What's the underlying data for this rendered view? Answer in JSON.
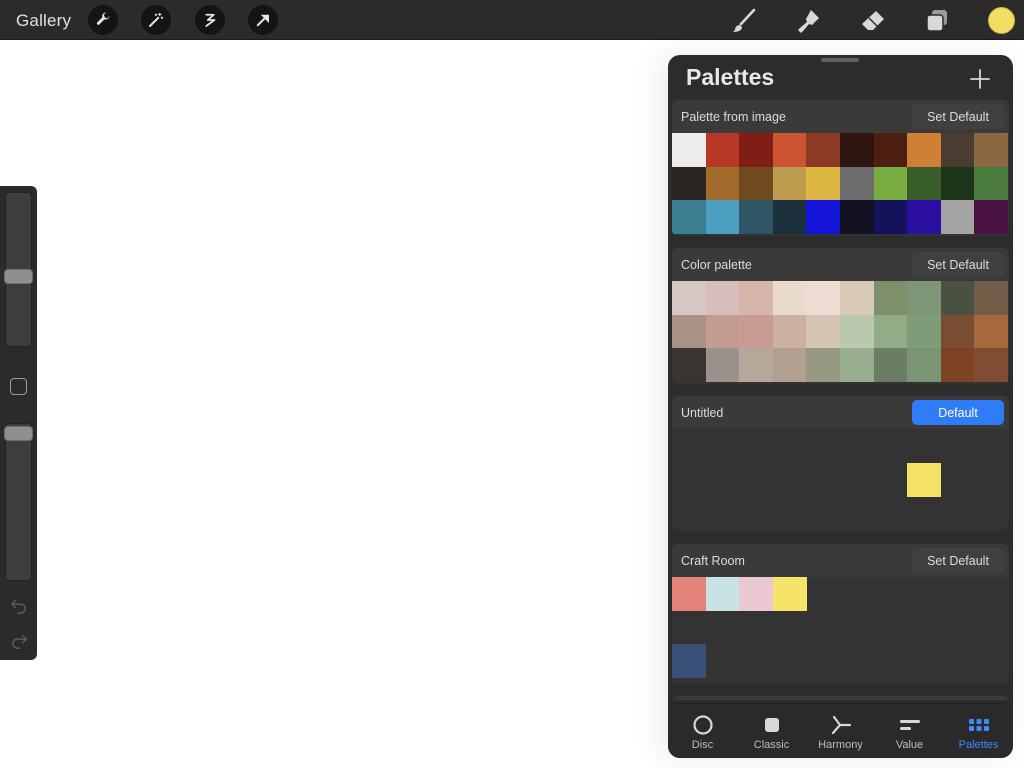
{
  "toolbar": {
    "gallery_label": "Gallery",
    "left_tools": [
      "wrench-icon",
      "magic-wand-icon",
      "selection-icon",
      "transform-arrow-icon"
    ],
    "right_tools": [
      "brush-icon",
      "smudge-icon",
      "eraser-icon",
      "layers-icon"
    ],
    "current_color": "#f3dd63"
  },
  "sidebar": {
    "brush_size_level": 0.55,
    "opacity_level": 0.0
  },
  "panel": {
    "title": "Palettes",
    "palettes": [
      {
        "name": "Palette from image",
        "button_label": "Set Default",
        "is_default": false,
        "swatches": [
          "#ececec",
          "#b83826",
          "#7e1e16",
          "#cc5433",
          "#8c3a26",
          "#2e1510",
          "#4d1e12",
          "#d07f37",
          "#4a3c30",
          "#8c6840",
          "#2b2621",
          "#a36b2b",
          "#6f4a1e",
          "#bd9b4f",
          "#ddb744",
          "#6c6c6c",
          "#79ad42",
          "#3a5e2a",
          "#1d351a",
          "#4b7b3c",
          "#3d7f92",
          "#4c9fc0",
          "#2d5564",
          "#1b303c",
          "#1414d8",
          "#121223",
          "#15125c",
          "#2a0fa0",
          "#a4a4a4",
          "#4a1143"
        ]
      },
      {
        "name": "Color palette",
        "button_label": "Set Default",
        "is_default": false,
        "swatches": [
          "#d5c7c3",
          "#d8bebb",
          "#d6b5ab",
          "#e8dacd",
          "#ecdcd1",
          "#d9c9b7",
          "#7e8f6b",
          "#7e9677",
          "#4a5140",
          "#725d49",
          "#a99288",
          "#c29b91",
          "#c99c93",
          "#ccb1a2",
          "#d6c5b2",
          "#bac9ae",
          "#93ac87",
          "#7d9c77",
          "#7a4d33",
          "#a8683e",
          "#3a3530",
          "#9b928d",
          "#b4a89a",
          "#b1a08f",
          "#979983",
          "#98ae8f",
          "#6b7d64",
          "#799573",
          "#7e4224",
          "#804c32"
        ]
      },
      {
        "name": "Untitled",
        "button_label": "Default",
        "is_default": true,
        "swatches": [
          null,
          null,
          null,
          null,
          null,
          null,
          null,
          null,
          null,
          null,
          null,
          null,
          null,
          null,
          null,
          null,
          null,
          "#f7e268",
          null,
          null
        ]
      },
      {
        "name": "Craft Room",
        "button_label": "Set Default",
        "is_default": false,
        "swatches": [
          "#e4837a",
          "#c8e2e6",
          "#ecc9d2",
          "#f5e36a",
          null,
          null,
          null,
          null,
          null,
          null,
          null,
          null,
          null,
          null,
          null,
          null,
          null,
          null,
          null,
          null,
          "#3b5078",
          null,
          null,
          null,
          null,
          null,
          null,
          null,
          null,
          null
        ]
      }
    ]
  },
  "tabs": [
    {
      "label": "Disc",
      "icon": "disc-icon",
      "active": false
    },
    {
      "label": "Classic",
      "icon": "classic-square-icon",
      "active": false
    },
    {
      "label": "Harmony",
      "icon": "harmony-icon",
      "active": false
    },
    {
      "label": "Value",
      "icon": "value-sliders-icon",
      "active": false
    },
    {
      "label": "Palettes",
      "icon": "palettes-grid-icon",
      "active": true
    }
  ]
}
